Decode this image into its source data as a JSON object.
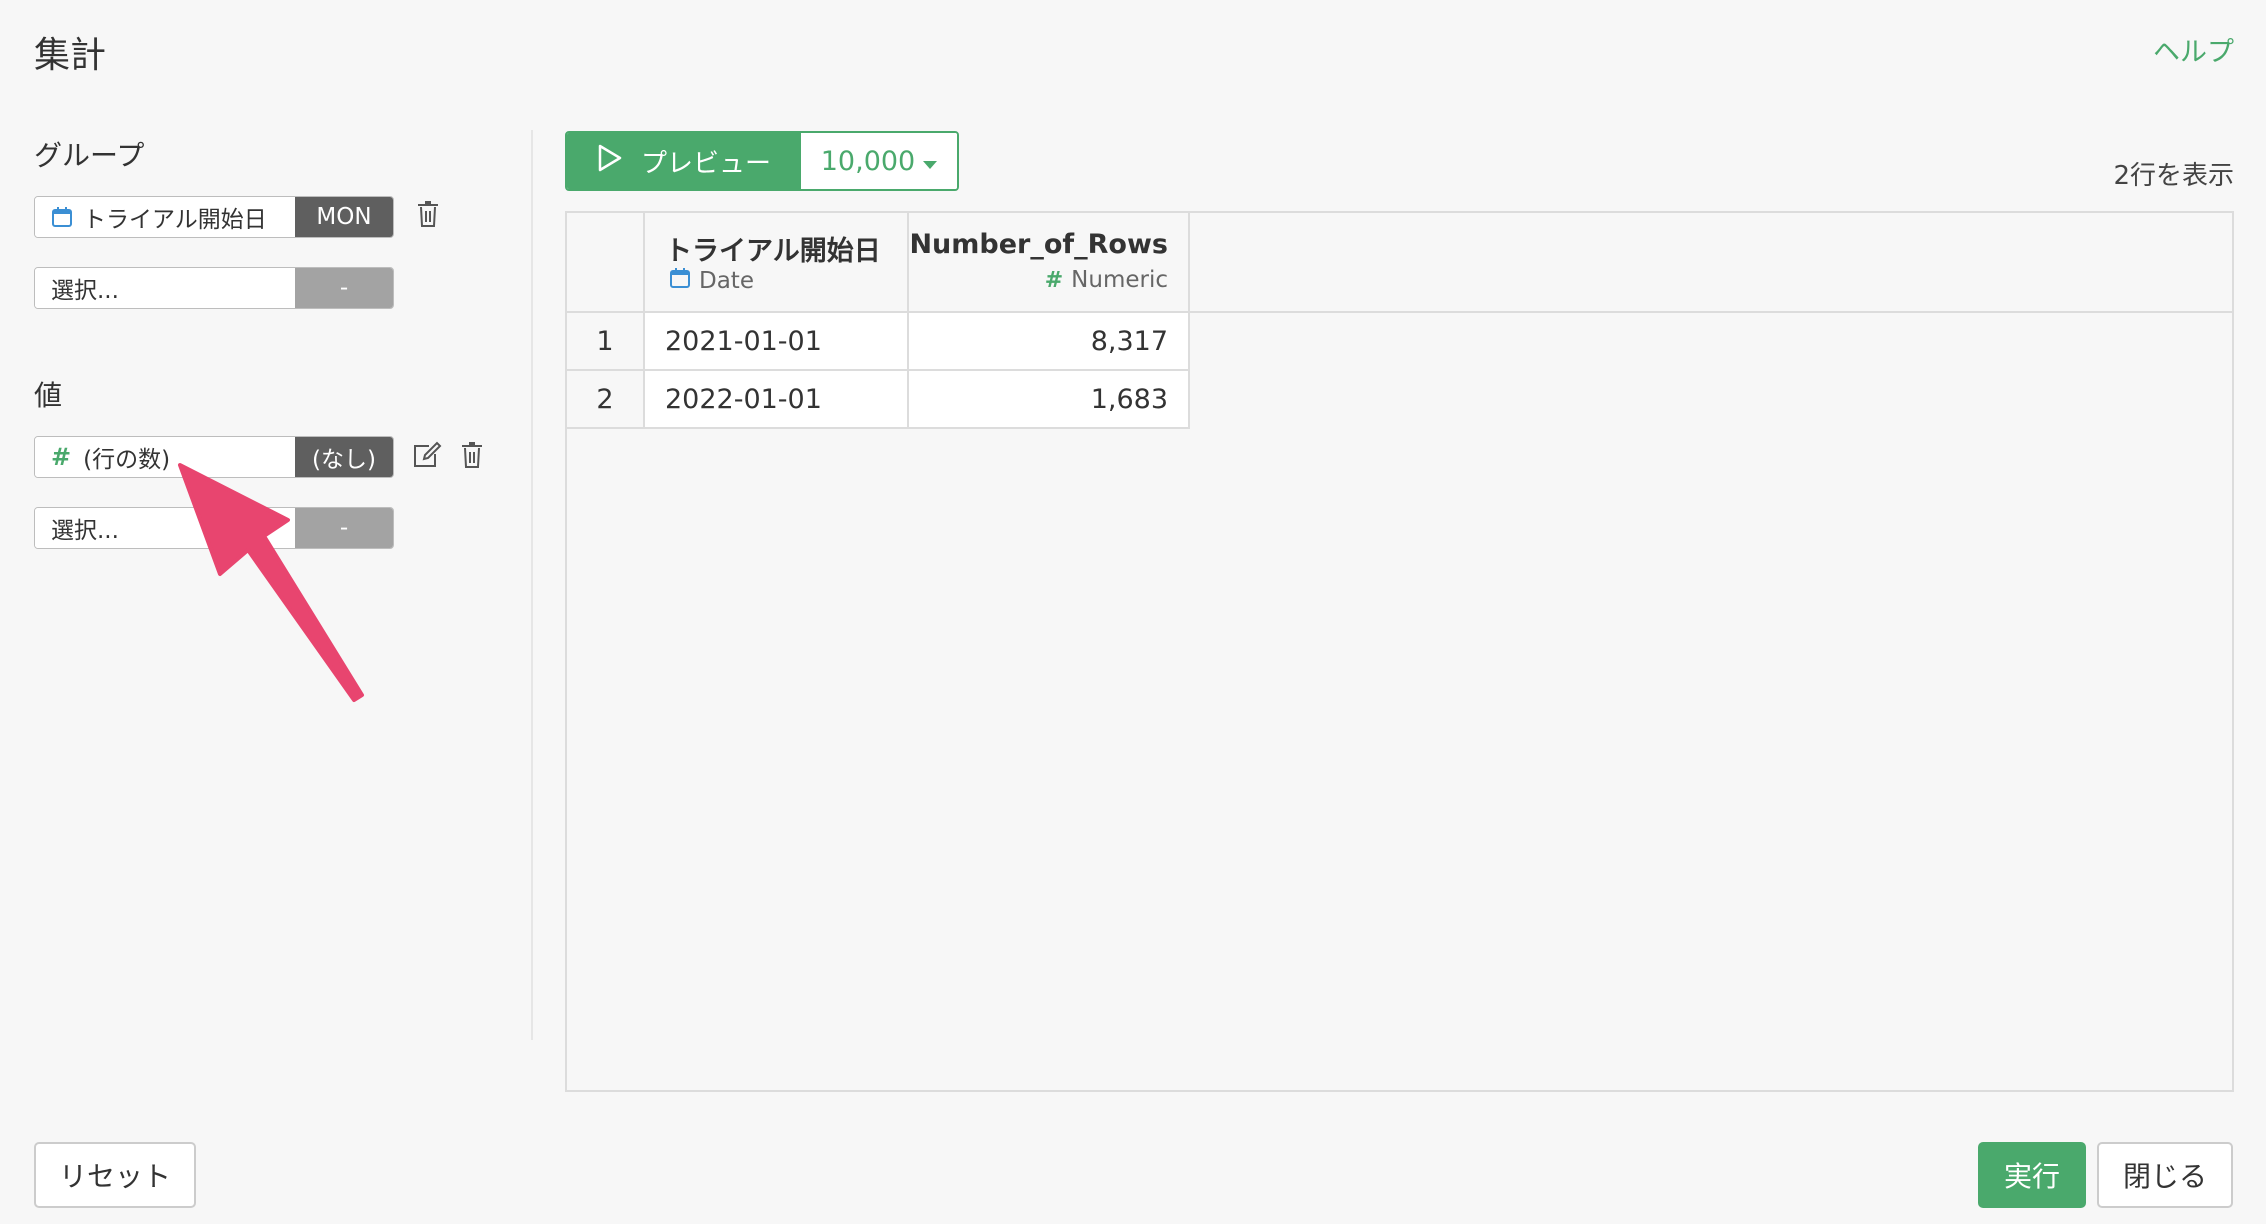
{
  "header": {
    "title": "集計",
    "help_label": "ヘルプ"
  },
  "group": {
    "label": "グループ",
    "fields": [
      {
        "name": "トライアル開始日",
        "modifier": "MON",
        "icon": "calendar-icon"
      },
      {
        "name": "選択...",
        "modifier": "-"
      }
    ]
  },
  "values": {
    "label": "値",
    "fields": [
      {
        "name": "(行の数)",
        "modifier": "(なし)",
        "icon": "hash-icon"
      },
      {
        "name": "選択...",
        "modifier": "-"
      }
    ]
  },
  "toolbar": {
    "preview_label": "プレビュー",
    "rows_option": "10,000",
    "row_count_text": "2行を表示"
  },
  "table": {
    "columns": [
      {
        "name": "トライアル開始日",
        "type": "Date",
        "type_icon": "calendar-icon"
      },
      {
        "name": "Number_of_Rows",
        "type": "Numeric",
        "type_icon": "hash-icon"
      }
    ],
    "rows": [
      {
        "index": "1",
        "cells": [
          "2021-01-01",
          "8,317"
        ]
      },
      {
        "index": "2",
        "cells": [
          "2022-01-01",
          "1,683"
        ]
      }
    ]
  },
  "footer": {
    "reset_label": "リセット",
    "run_label": "実行",
    "close_label": "閉じる"
  },
  "colors": {
    "accent": "#4aa96c",
    "modifier_bg": "#5f5f5f",
    "arrow": "#e8456f",
    "date_icon": "#3b8fd4"
  }
}
